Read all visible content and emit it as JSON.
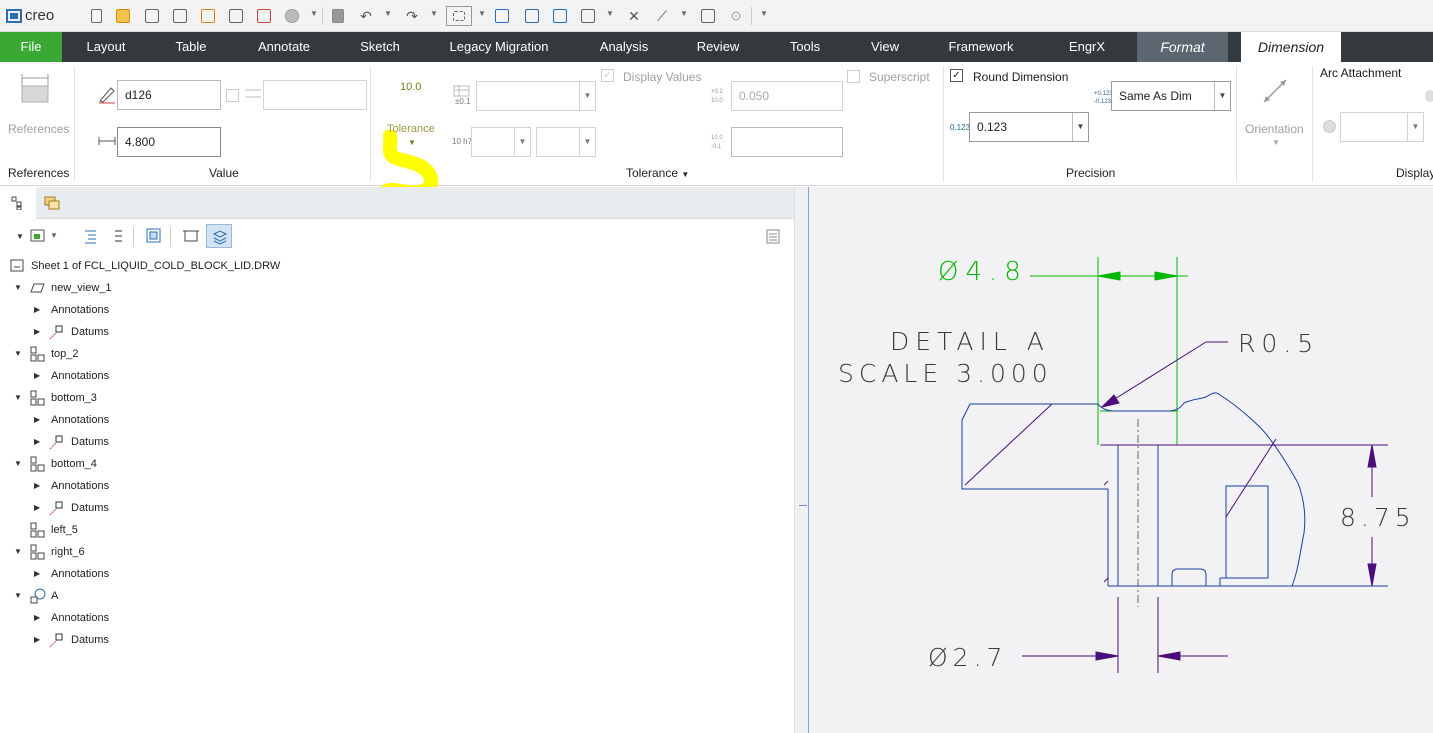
{
  "app": {
    "logo_text": "creo"
  },
  "tabs": [
    {
      "label": "File"
    },
    {
      "label": "Layout"
    },
    {
      "label": "Table"
    },
    {
      "label": "Annotate"
    },
    {
      "label": "Sketch"
    },
    {
      "label": "Legacy Migration"
    },
    {
      "label": "Analysis"
    },
    {
      "label": "Review"
    },
    {
      "label": "Tools"
    },
    {
      "label": "View"
    },
    {
      "label": "Framework"
    },
    {
      "label": "EngrX"
    },
    {
      "label": "Format"
    },
    {
      "label": "Dimension"
    }
  ],
  "ribbon": {
    "references": {
      "button_label": "References",
      "group_label": "References"
    },
    "value": {
      "dim_name": "d126",
      "dim_value": "4.800",
      "override_value": "",
      "group_label": "Value"
    },
    "tolerance": {
      "button_label": "Tolerance",
      "button_icon_text": "10.0",
      "display_values_label": "Display Values",
      "upper_value": "0.050",
      "lower_value": "",
      "superscript_label": "Superscript",
      "group_label": "Tolerance",
      "icon_fit": "10 h7",
      "icon_table": "±0.1"
    },
    "precision": {
      "round_label": "Round Dimension",
      "round_checked": true,
      "precision_value": "0.123",
      "tol_precision_value": "Same As Dim",
      "group_label": "Precision",
      "icon_precision": "0.123"
    },
    "display": {
      "orientation_label": "Orientation",
      "arc_attachment_label": "Arc Attachment",
      "group_label": "Display"
    }
  },
  "tree": {
    "root": "Sheet 1 of FCL_LIQUID_COLD_BLOCK_LID.DRW",
    "items": [
      {
        "label": "new_view_1",
        "level": 1,
        "expanded": true
      },
      {
        "label": "Annotations",
        "level": 2
      },
      {
        "label": "Datums",
        "level": 2
      },
      {
        "label": "top_2",
        "level": 1,
        "expanded": true
      },
      {
        "label": "Annotations",
        "level": 2
      },
      {
        "label": "bottom_3",
        "level": 1,
        "expanded": true
      },
      {
        "label": "Annotations",
        "level": 2
      },
      {
        "label": "Datums",
        "level": 2
      },
      {
        "label": "bottom_4",
        "level": 1,
        "expanded": true
      },
      {
        "label": "Annotations",
        "level": 2
      },
      {
        "label": "Datums",
        "level": 2
      },
      {
        "label": "left_5",
        "level": 1
      },
      {
        "label": "right_6",
        "level": 1,
        "expanded": true
      },
      {
        "label": "Annotations",
        "level": 2
      },
      {
        "label": "A",
        "level": 1,
        "expanded": true
      },
      {
        "label": "Annotations",
        "level": 2
      },
      {
        "label": "Datums",
        "level": 2
      }
    ]
  },
  "drawing": {
    "dim_top": "Ø4.8",
    "detail_title": "DETAIL A",
    "detail_scale": "SCALE 3.000",
    "radius": "R0.5",
    "height": "8.75",
    "dim_bottom": "Ø2.7"
  },
  "colors": {
    "accent_green": "#3aa835",
    "tab_bar": "#34393e",
    "highlight": "#ffff00",
    "dim_selected": "#00b800",
    "dim_line": "#4a0f7a",
    "geometry": "#1a3e9e"
  }
}
